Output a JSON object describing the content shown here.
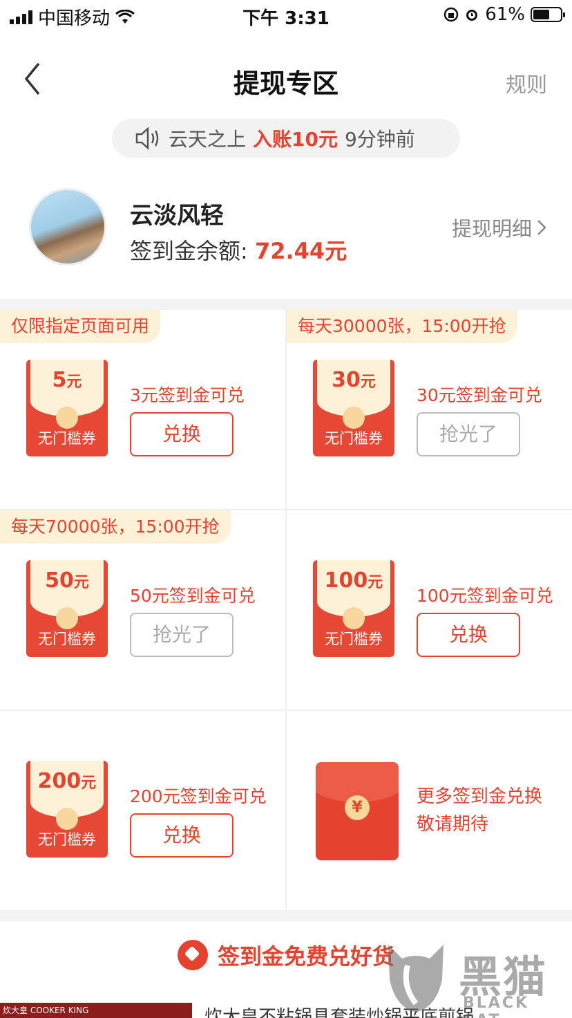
{
  "status": {
    "carrier": "中国移动",
    "time": "下午 3:31",
    "battery": "61%"
  },
  "header": {
    "title": "提现专区",
    "rules": "规则"
  },
  "ticker": {
    "name": "云天之上",
    "action": "入账10元",
    "time": "9分钟前"
  },
  "user": {
    "name": "云淡风轻",
    "balance_label": "签到金余额:",
    "balance_value": "72.44元",
    "detail_link": "提现明细"
  },
  "coupons": [
    {
      "tag": "仅限指定页面可用",
      "amount": "5",
      "unit": "元",
      "label": "无门槛券",
      "desc": "3元签到金可兑",
      "button": "兑换",
      "state": "active"
    },
    {
      "tag": "每天30000张，15:00开抢",
      "amount": "30",
      "unit": "元",
      "label": "无门槛券",
      "desc": "30元签到金可兑",
      "button": "抢光了",
      "state": "soldout"
    },
    {
      "tag": "每天70000张，15:00开抢",
      "amount": "50",
      "unit": "元",
      "label": "无门槛券",
      "desc": "50元签到金可兑",
      "button": "抢光了",
      "state": "soldout"
    },
    {
      "tag": "",
      "amount": "100",
      "unit": "元",
      "label": "无门槛券",
      "desc": "100元签到金可兑",
      "button": "兑换",
      "state": "active"
    },
    {
      "tag": "",
      "amount": "200",
      "unit": "元",
      "label": "无门槛券",
      "desc": "200元签到金可兑",
      "button": "兑换",
      "state": "active"
    }
  ],
  "more": {
    "symbol": "¥",
    "line1": "更多签到金兑换",
    "line2": "敬请期待"
  },
  "promo": {
    "title": "签到金免费兑好货",
    "product": "炊大皇不粘锅具套装炒锅平底煎锅",
    "thumb_text": "炊大皇 COOKER KING"
  },
  "watermark": {
    "cn": "黑猫",
    "en": "BLACK CAT"
  },
  "colors": {
    "accent": "#e5432f",
    "cream": "#fdf1d8"
  }
}
